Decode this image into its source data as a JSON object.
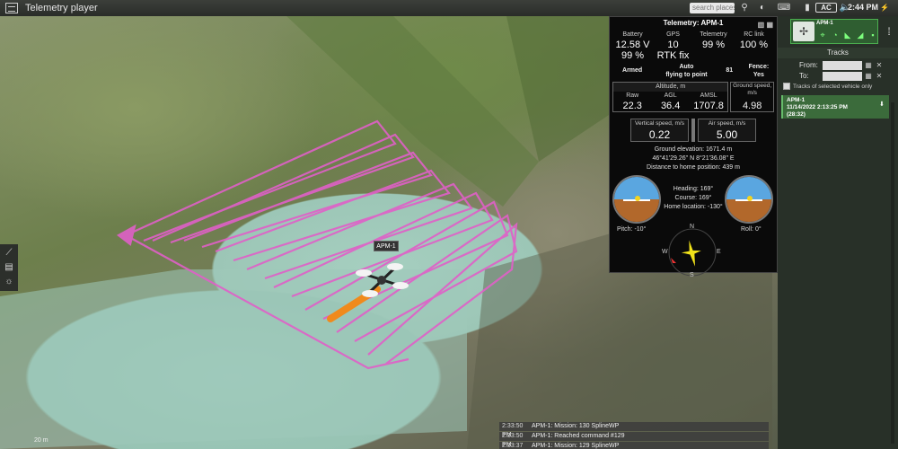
{
  "window": {
    "title": "Telemetry player"
  },
  "toolbar": {
    "search_placeholder": "search places",
    "ac_label": "AC",
    "clock": "2:44 PM"
  },
  "telemetry": {
    "title": "Telemetry: APM-1",
    "top": [
      {
        "label": "Battery",
        "value1": "12.58 V",
        "value2": "99 %"
      },
      {
        "label": "GPS",
        "value1": "10",
        "value2": "RTK fix"
      },
      {
        "label": "Telemetry",
        "value1": "",
        "value2": "99 %"
      },
      {
        "label": "RC link",
        "value1": "",
        "value2": "100 %"
      }
    ],
    "armed": "Armed",
    "mode": "Auto\nflying to point",
    "mode_line1": "Auto",
    "mode_line2": "flying to point",
    "point": "81",
    "fence_line1": "Fence:",
    "fence_line2": "Yes",
    "altitude_title": "Altitude, m",
    "altitude": [
      {
        "label": "Raw",
        "value": "22.3"
      },
      {
        "label": "AGL",
        "value": "36.4"
      },
      {
        "label": "AMSL",
        "value": "1707.8"
      }
    ],
    "ground_speed_label": "Ground speed, m/s",
    "ground_speed": "4.98",
    "vertical_speed_label": "Vertical speed, m/s",
    "vertical_speed": "0.22",
    "air_speed_label": "Air speed, m/s",
    "air_speed": "5.00",
    "ground_elevation": "Ground elevation: 1671.4 m",
    "coordinates": "46°41'29.26\" N  8°21'36.08\" E",
    "distance_home": "Distance to home position: 439 m",
    "heading": "Heading: 169°",
    "course": "Course: 169°",
    "home_location": "Home location: -130°",
    "pitch": "Pitch: -10°",
    "roll": "Roll: 0°",
    "compass": {
      "n": "N",
      "e": "E",
      "s": "S",
      "w": "W"
    }
  },
  "map": {
    "vehicle_label": "APM-1",
    "scale_text": "20 m"
  },
  "sidebar": {
    "vehicle_name": "APM-1",
    "tracks_title": "Tracks",
    "from_label": "From:",
    "to_label": "To:",
    "only_selected_label": "Tracks of selected vehicle only",
    "track_item": {
      "name": "APM-1",
      "date": "11/14/2022 2:13:25 PM",
      "duration": "(28:32)"
    }
  },
  "log": [
    {
      "time": "2:33:50 PM",
      "message": "APM-1: Mission: 130 SplineWP"
    },
    {
      "time": "2:33:50 PM",
      "message": "APM-1: Reached command #129"
    },
    {
      "time": "2:33:37 PM",
      "message": "APM-1: Mission: 129 SplineWP"
    }
  ],
  "colors": {
    "track": "#e060c8",
    "accent_green": "#4caf50",
    "orange_path": "#f08a1c"
  }
}
